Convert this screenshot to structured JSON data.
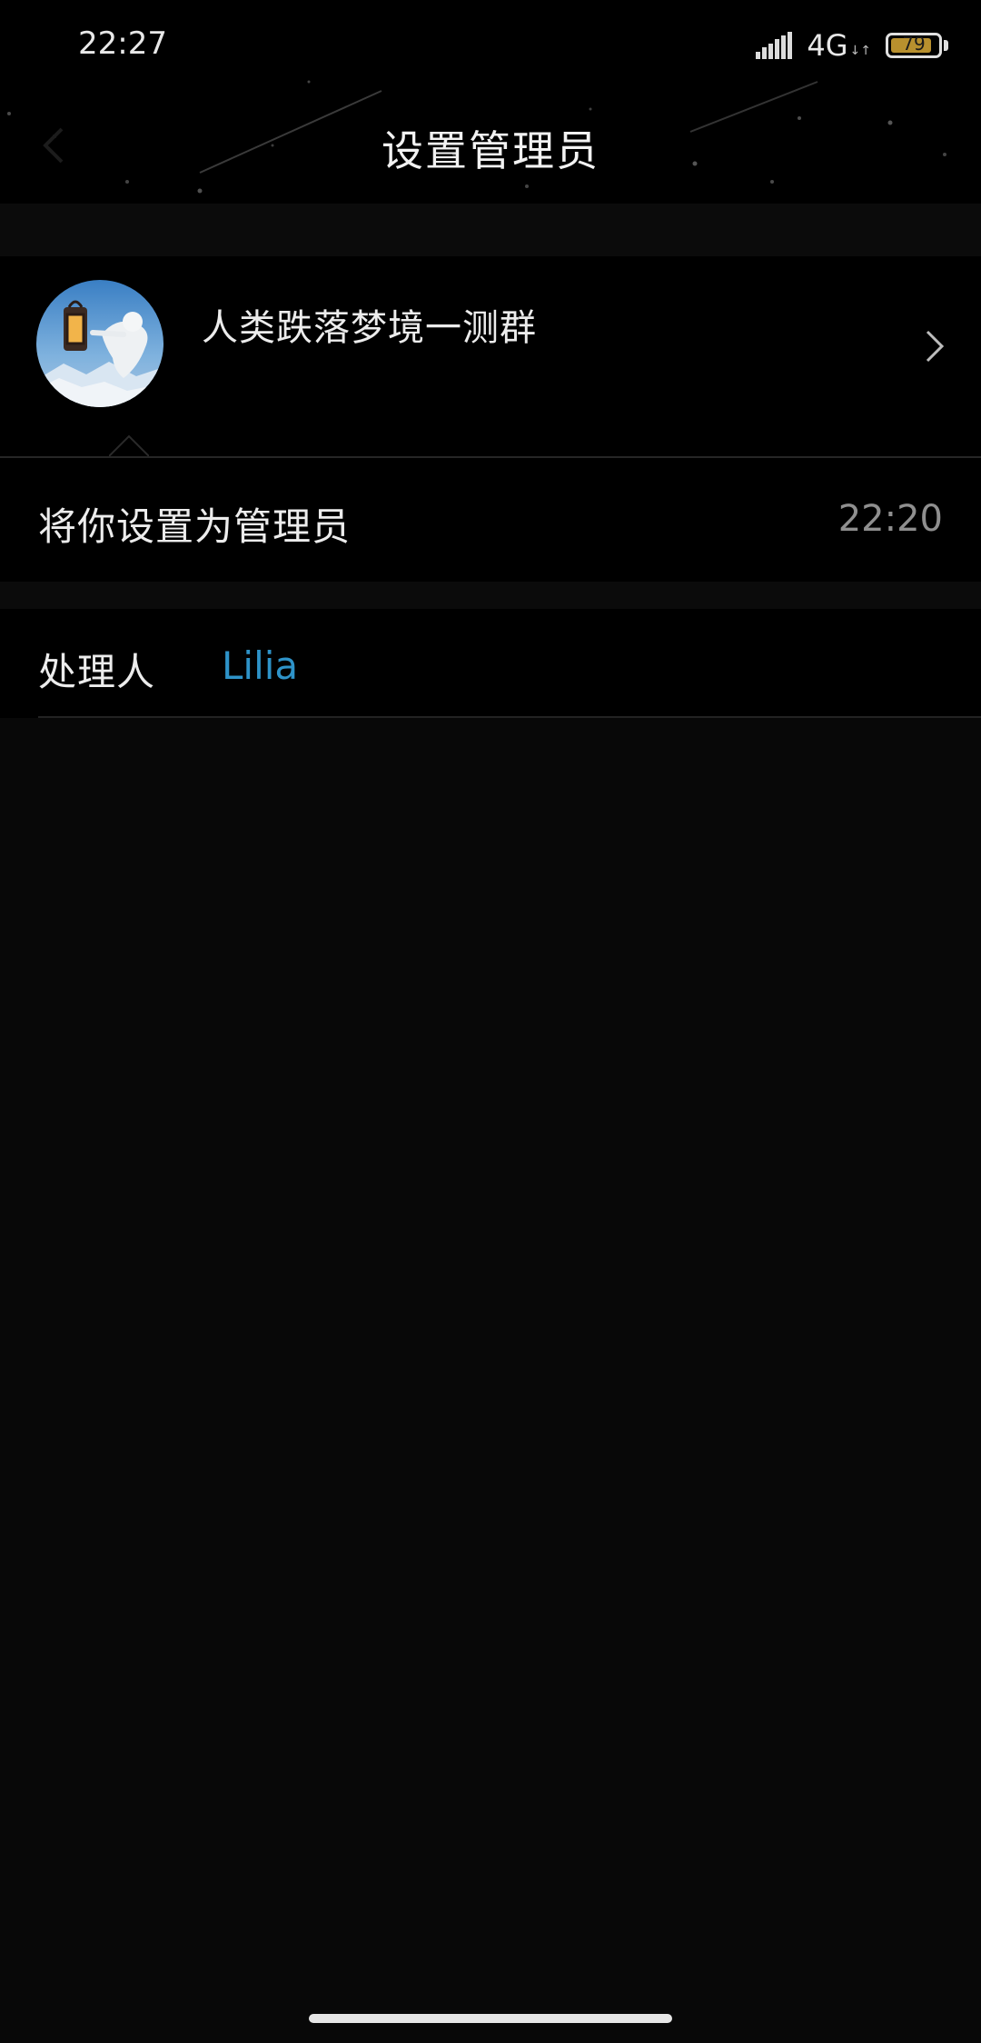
{
  "status_bar": {
    "time": "22:27",
    "network": "4G",
    "network_activity": "↓↑",
    "battery": "79"
  },
  "header": {
    "title": "设置管理员"
  },
  "group": {
    "name": "人类跌落梦境一测群"
  },
  "notice": {
    "text": "将你设置为管理员",
    "time": "22:20"
  },
  "handler": {
    "label": "处理人",
    "name": "Lilia"
  },
  "colors": {
    "background": "#080808",
    "link": "#2e93c9",
    "battery": "#b8902e"
  }
}
